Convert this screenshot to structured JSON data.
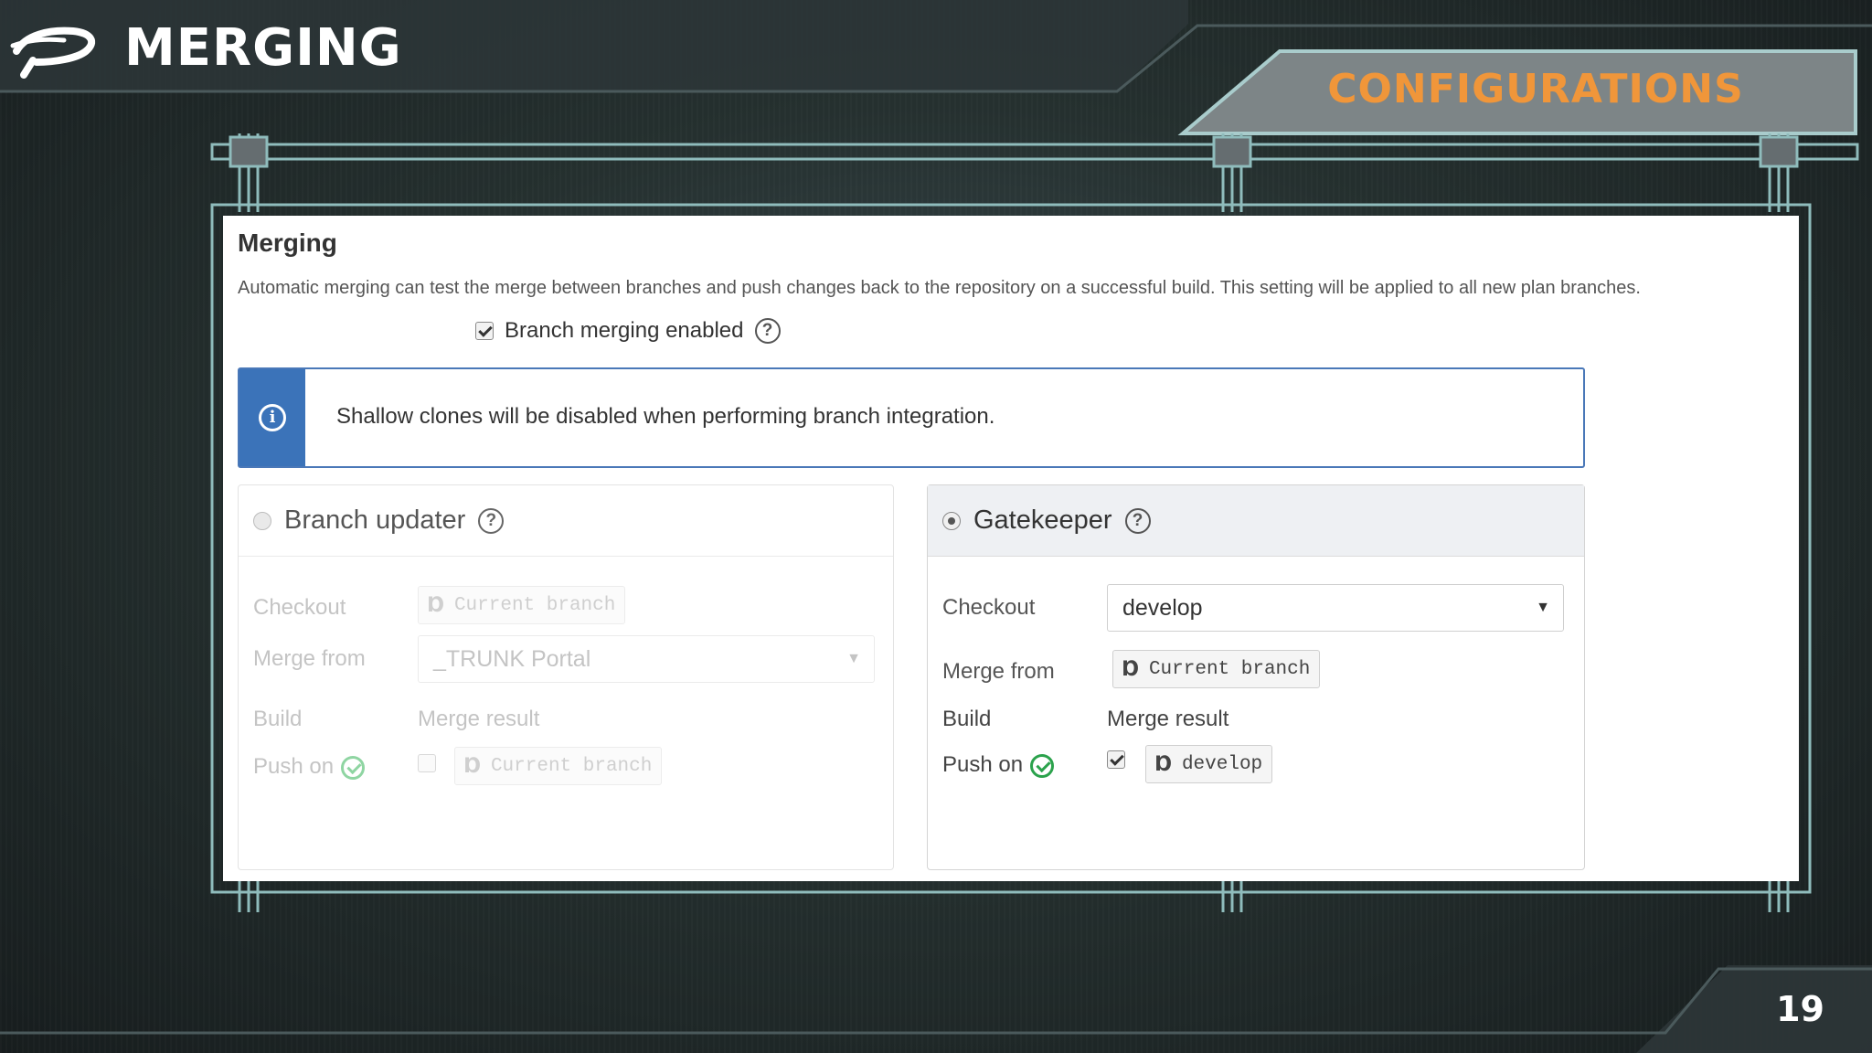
{
  "slide": {
    "title": "MERGING",
    "section": "CONFIGURATIONS",
    "page_number": "19",
    "colors": {
      "title": "#ffffff",
      "section": "#f0963a",
      "frame": "#8fbcbc"
    }
  },
  "panel": {
    "title": "Merging",
    "description": "Automatic merging can test the merge between branches and push changes back to the repository on a successful build. This setting will be applied to all new plan branches.",
    "enable_label": "Branch merging enabled",
    "enable_checked": true,
    "info_message": "Shallow clones will be disabled when performing branch integration.",
    "info_color": "#3b73b9"
  },
  "branch_updater": {
    "title": "Branch updater",
    "selected": false,
    "checkout_label": "Checkout",
    "checkout_value": "Current branch",
    "merge_from_label": "Merge from",
    "merge_from_value": "_TRUNK Portal",
    "build_label": "Build",
    "merge_result_label": "Merge result",
    "push_on_label": "Push on",
    "push_target": "Current branch",
    "push_checked": false
  },
  "gatekeeper": {
    "title": "Gatekeeper",
    "selected": true,
    "checkout_label": "Checkout",
    "checkout_value": "develop",
    "merge_from_label": "Merge from",
    "merge_from_value": "Current branch",
    "build_label": "Build",
    "merge_result_label": "Merge result",
    "push_on_label": "Push on",
    "push_target": "develop",
    "push_checked": true
  },
  "icons": {
    "logo": "brand-logo-icon",
    "help": "question-circle-icon",
    "info": "info-circle-icon",
    "branch": "git-branch-icon",
    "ok": "check-circle-icon",
    "caret": "caret-down-icon"
  }
}
